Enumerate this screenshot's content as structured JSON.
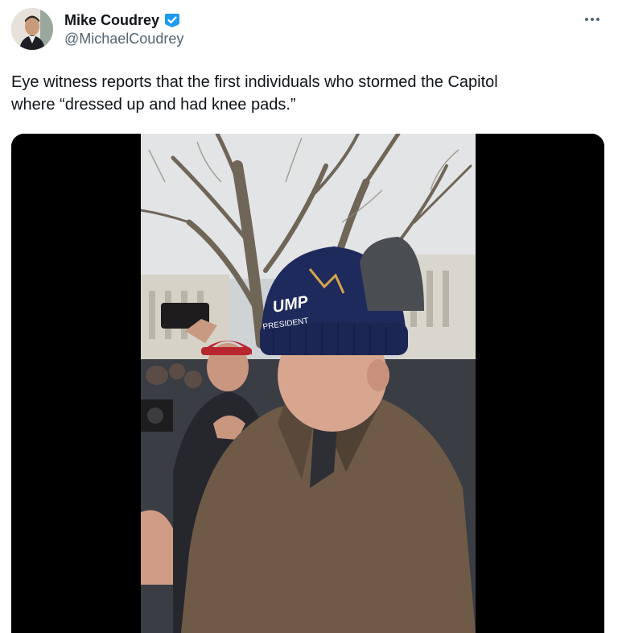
{
  "author": {
    "display_name": "Mike Coudrey",
    "handle": "@MichaelCoudrey",
    "verified": true,
    "verified_color": "#1d9bf0"
  },
  "tweet": {
    "text": "Eye witness reports that the first individuals who stormed the Capitol\nwhere “dressed up and had knee pads.”"
  },
  "media": {
    "type": "video-still",
    "hat_text_line1": "UMP",
    "hat_text_line2": "PRESIDENT"
  },
  "icons": {
    "more": "more-horizontal-icon",
    "verified": "verified-badge-icon"
  },
  "colors": {
    "text_primary": "#0f1419",
    "text_secondary": "#536471",
    "media_background": "#000000"
  }
}
